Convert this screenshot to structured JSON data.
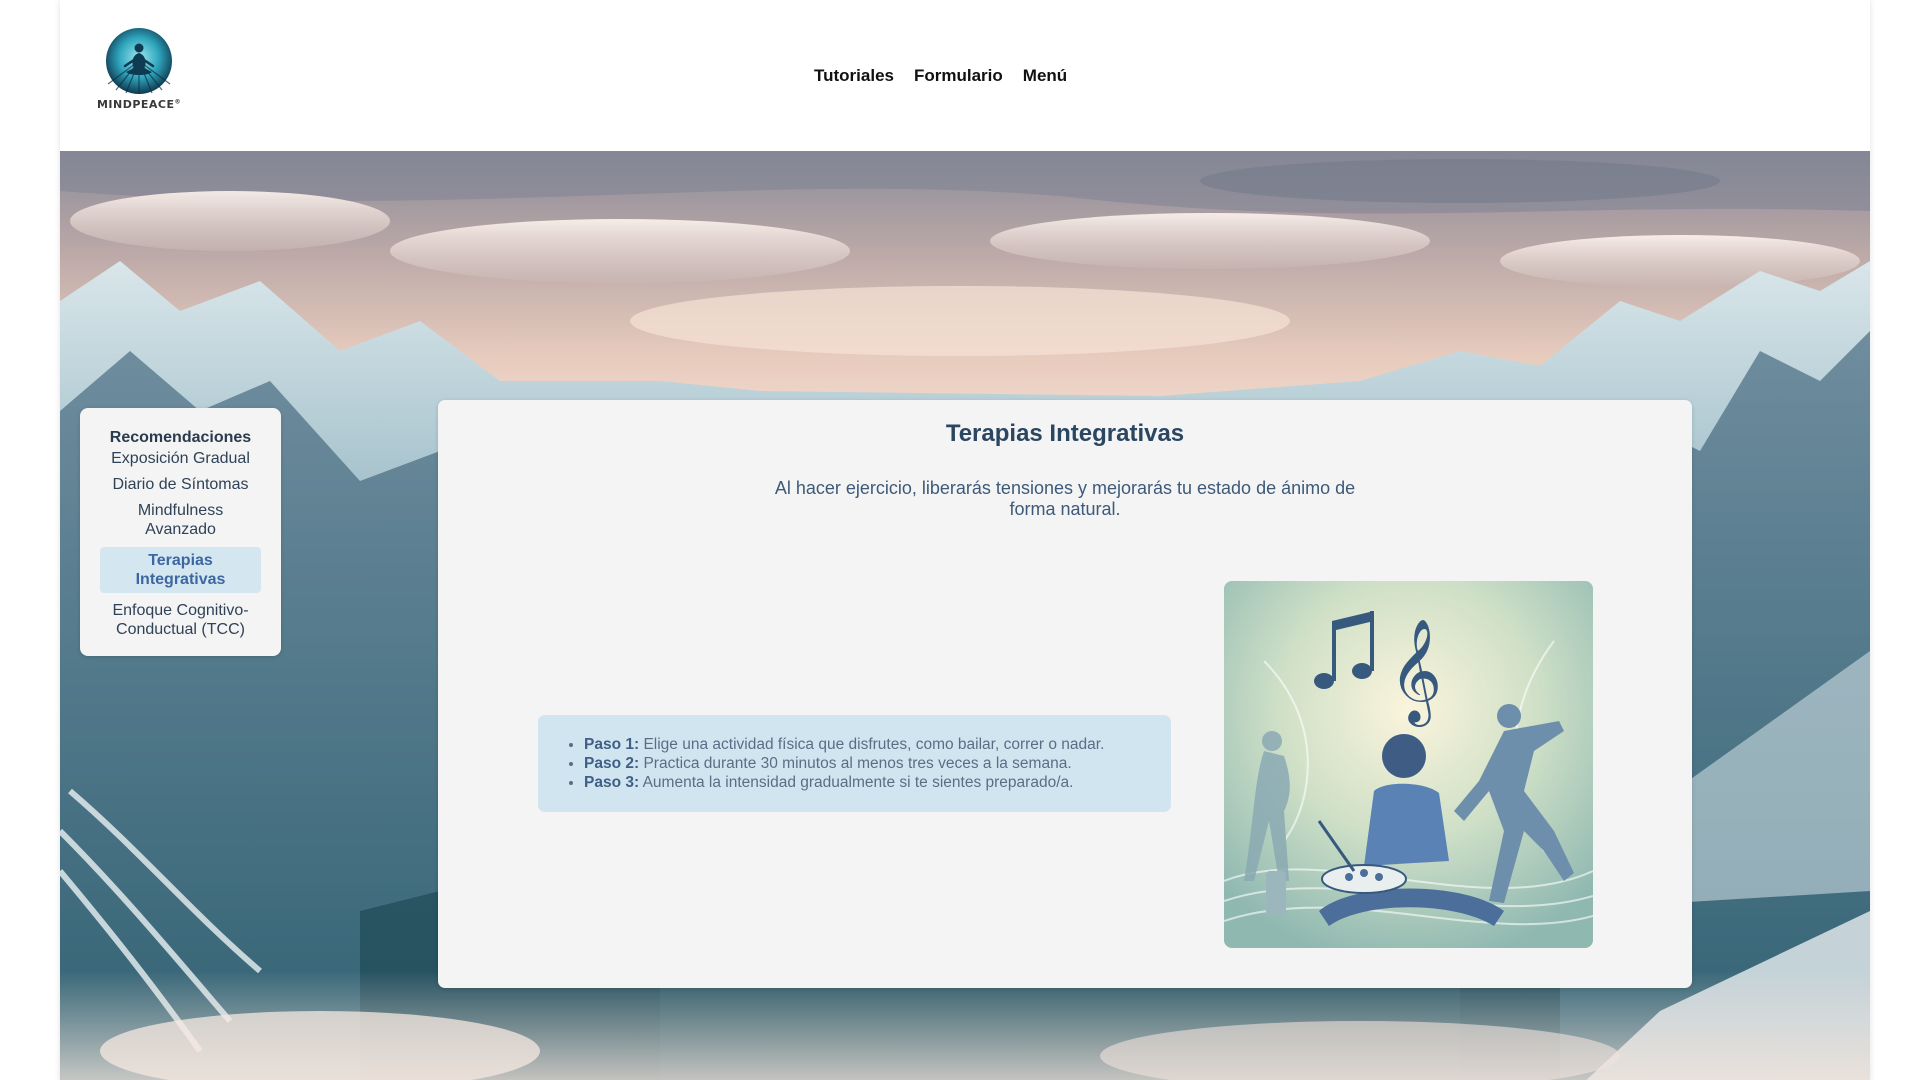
{
  "header": {
    "logo_text": "MINDPEACE",
    "nav": [
      "Tutoriales",
      "Formulario",
      "Menú"
    ]
  },
  "sidebar": {
    "title": "Recomendaciones",
    "items": [
      {
        "label": "Exposición Gradual"
      },
      {
        "label": "Diario de Síntomas"
      },
      {
        "label": "Mindfulness Avanzado"
      },
      {
        "label": "Terapias Integrativas",
        "active": true
      },
      {
        "label": "Enfoque Cognitivo-Conductual (TCC)"
      }
    ]
  },
  "main": {
    "title": "Terapias Integrativas",
    "description": "Al hacer ejercicio, liberarás tensiones y mejorarás tu estado de ánimo de forma natural.",
    "steps": [
      {
        "label": "Paso 1:",
        "text": " Elige una actividad física que disfrutes, como bailar, correr o nadar."
      },
      {
        "label": "Paso 2:",
        "text": " Practica durante 30 minutos al menos tres veces a la semana."
      },
      {
        "label": "Paso 3:",
        "text": " Aumenta la intensidad gradualmente si te sientes preparado/a."
      }
    ],
    "illustration": "music-and-movement-therapy-illustration"
  },
  "colors": {
    "accent": "#3d67a0",
    "title": "#2b4661",
    "steps_bg": "#d1e5f0",
    "panel_bg": "#f4f4f5"
  }
}
